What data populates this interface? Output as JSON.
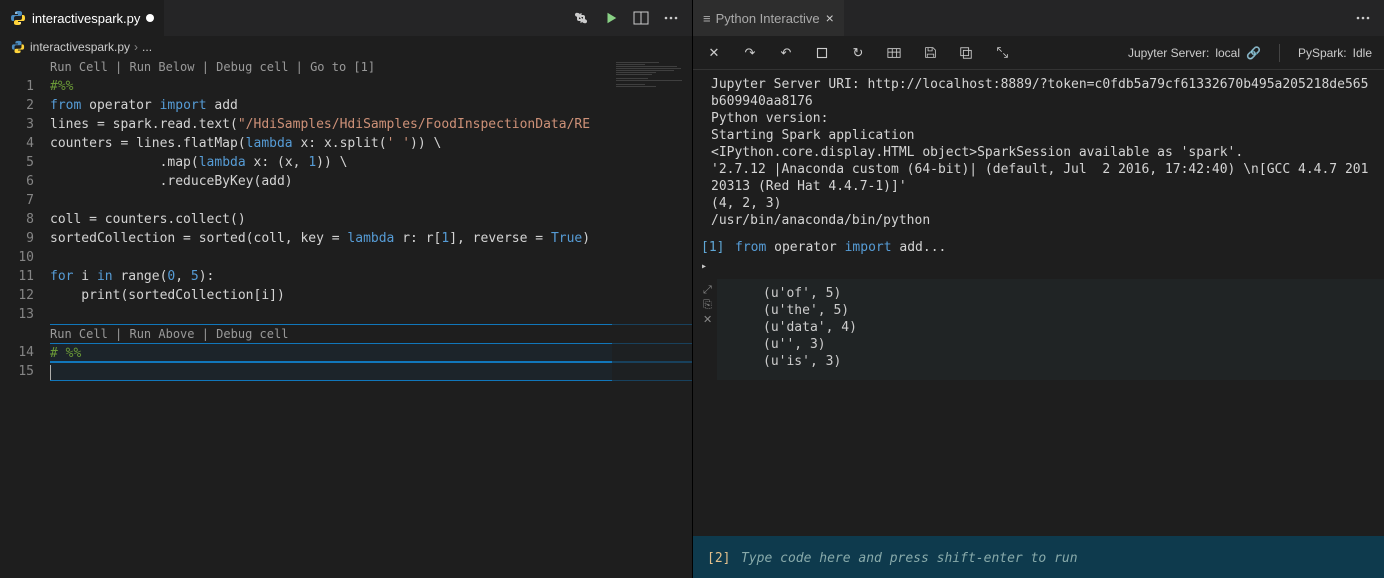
{
  "editor": {
    "tab": {
      "filename": "interactivespark.py",
      "dirty": true
    },
    "breadcrumb": {
      "filename": "interactivespark.py",
      "trail": "..."
    },
    "codelens1": "Run Cell | Run Below | Debug cell | Go to [1]",
    "codelens2": "Run Cell | Run Above | Debug cell",
    "lines": {
      "l1": "#%%",
      "l2a": "from",
      "l2b": " operator ",
      "l2c": "import",
      "l2d": " add",
      "l3a": "lines = spark.read.text(",
      "l3b": "\"/HdiSamples/HdiSamples/FoodInspectionData/RE",
      "l4a": "counters = lines.flatMap(",
      "l4b": "lambda",
      "l4c": " x: x.split(",
      "l4d": "' '",
      "l4e": ")) \\",
      "l5a": "              .map(",
      "l5b": "lambda",
      "l5c": " x: (x, ",
      "l5d": "1",
      "l5e": ")) \\",
      "l6": "              .reduceByKey(add)",
      "l8": "coll = counters.collect()",
      "l9a": "sortedCollection = sorted(coll, key = ",
      "l9b": "lambda",
      "l9c": " r: r[",
      "l9d": "1",
      "l9e": "], reverse = ",
      "l9f": "True",
      "l9g": ")",
      "l11a": "for",
      "l11b": " i ",
      "l11c": "in",
      "l11d": " range(",
      "l11e": "0",
      "l11f": ", ",
      "l11g": "5",
      "l11h": "):",
      "l12a": "    print(sortedCollection[i])",
      "l14": "# %%"
    },
    "line_numbers": [
      "1",
      "2",
      "3",
      "4",
      "5",
      "6",
      "7",
      "8",
      "9",
      "10",
      "11",
      "12",
      "13",
      "14",
      "15"
    ]
  },
  "interactive": {
    "title": "Python Interactive",
    "status": {
      "server_label": "Jupyter Server: ",
      "server_value": "local",
      "pyspark_label": "PySpark: ",
      "pyspark_value": "Idle"
    },
    "output": [
      "Jupyter Server URI: http://localhost:8889/?token=c0fdb5a79cf61332670b495a205218de565b609940aa8176",
      "Python version:",
      "Starting Spark application",
      "<IPython.core.display.HTML object>SparkSession available as 'spark'.",
      "'2.7.12 |Anaconda custom (64-bit)| (default, Jul  2 2016, 17:42:40) \\n[GCC 4.4.7 20120313 (Red Hat 4.4.7-1)]'",
      "(4, 2, 3)",
      "/usr/bin/anaconda/bin/python"
    ],
    "cell1": {
      "prompt": "[1]",
      "code_from": "from",
      "code_operator": " operator ",
      "code_import": "import",
      "code_add": " add",
      "ellipsis": "..."
    },
    "cell1_out": [
      "(u'of', 5)",
      "(u'the', 5)",
      "(u'data', 4)",
      "(u'', 3)",
      "(u'is', 3)"
    ],
    "input": {
      "prompt": "[2]",
      "placeholder": "Type code here and press shift-enter to run"
    }
  }
}
